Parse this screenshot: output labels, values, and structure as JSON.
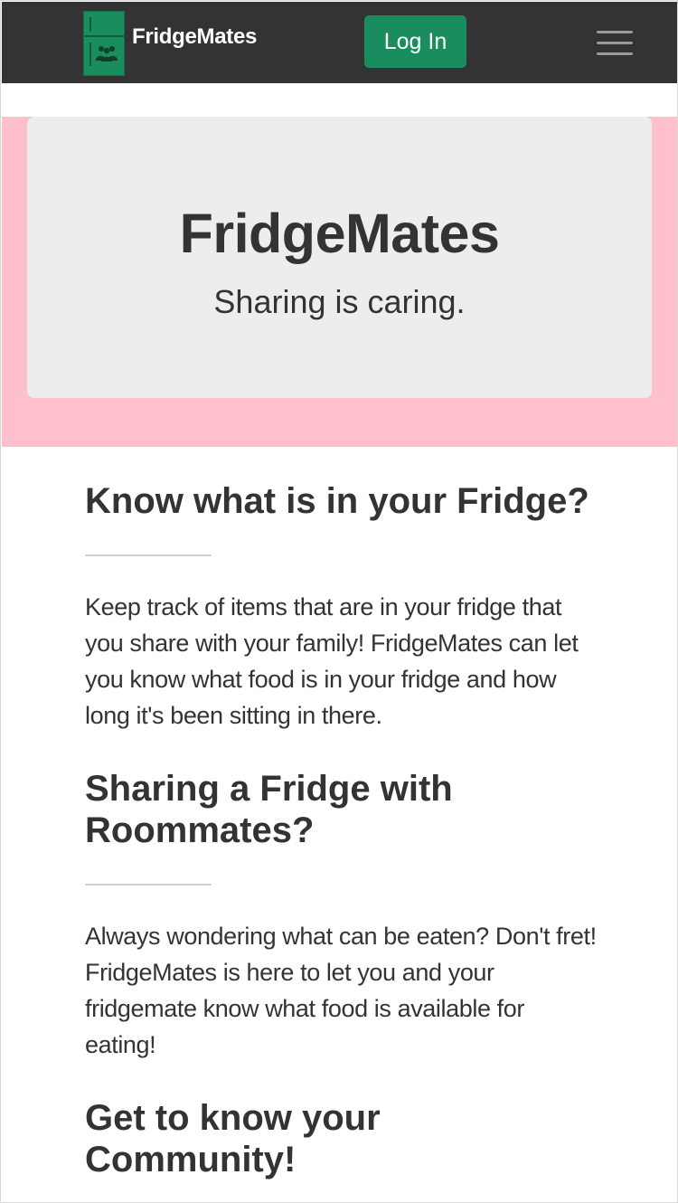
{
  "navbar": {
    "brand_name": "FridgeMates",
    "login_label": "Log In"
  },
  "hero": {
    "title": "FridgeMates",
    "subtitle": "Sharing is caring."
  },
  "sections": [
    {
      "heading": "Know what is in your Fridge?",
      "body": "Keep track of items that are in your fridge that you share with your family! FridgeMates can let you know what food is in your fridge and how long it's been sitting in there."
    },
    {
      "heading": "Sharing a Fridge with Roommates?",
      "body": "Always wondering what can be eaten? Don't fret! FridgeMates is here to let you and your fridgemate know what food is available for eating!"
    },
    {
      "heading": "Get to know your Community!",
      "body": ""
    }
  ],
  "colors": {
    "navbar_bg": "#333333",
    "brand_green": "#1a8d5e",
    "hero_bg": "#ffc0cb",
    "jumbotron_bg": "#ededed"
  },
  "icons": {
    "logo": "fridge-people-icon",
    "menu": "hamburger-icon"
  }
}
